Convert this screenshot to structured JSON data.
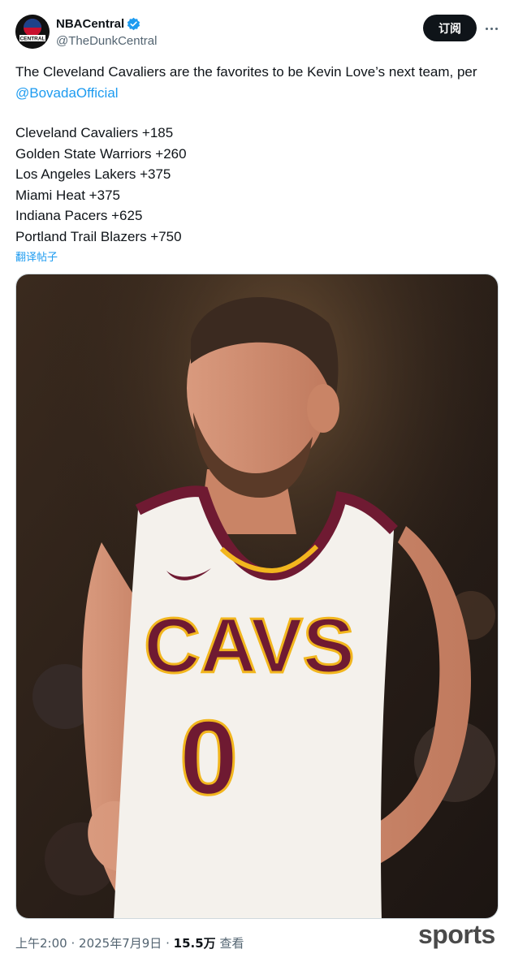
{
  "author": {
    "display_name": "NBACentral",
    "handle": "@TheDunkCentral",
    "avatar_text": "CENTRAL"
  },
  "actions": {
    "subscribe_label": "订阅"
  },
  "tweet": {
    "text_before_mention": "The Cleveland Cavaliers are the favorites to be Kevin Love’s next team, per ",
    "mention": "@BovadaOfficial",
    "odds": [
      "Cleveland Cavaliers +185",
      "Golden State Warriors +260",
      "Los Angeles Lakers +375",
      "Miami Heat +375",
      "Indiana Pacers +625",
      "Portland Trail Blazers +750"
    ],
    "translate_label": "翻译帖子"
  },
  "media": {
    "jersey_text": "CAVS",
    "jersey_number": "0"
  },
  "footer": {
    "time": "上午2:00",
    "separator": "·",
    "date": "2025年7月9日",
    "views_count": "15.5万",
    "views_label": "查看"
  },
  "watermark": "sports",
  "colors": {
    "link": "#1d9bf0",
    "text": "#0f1419",
    "muted": "#536471",
    "verified": "#1d9bf0",
    "jersey_wine": "#6f1a32",
    "jersey_gold": "#f2b61e"
  },
  "icons": [
    "verified-badge-icon",
    "more-options-icon"
  ]
}
